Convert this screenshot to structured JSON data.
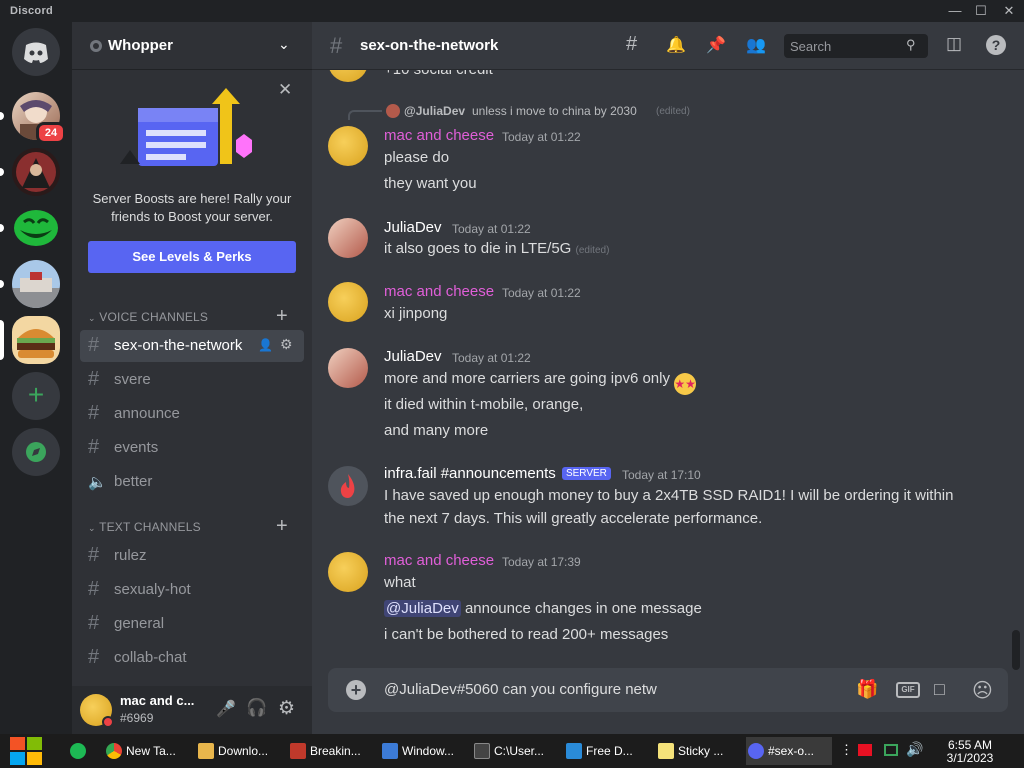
{
  "window": {
    "app_name": "Discord"
  },
  "colors": {
    "blurple": "#5865f2",
    "pink_name": "#e05fd8",
    "green": "#3ba55c",
    "red": "#ed4245"
  },
  "guilds": {
    "unread_badge": "24"
  },
  "server": {
    "name": "Whopper"
  },
  "boost": {
    "text": "Server Boosts are here! Rally your friends to Boost your server.",
    "button": "See Levels & Perks"
  },
  "categories": {
    "voice": "VOICE CHANNELS",
    "text": "TEXT CHANNELS"
  },
  "voice_channels": [
    {
      "label": "sex-on-the-network"
    },
    {
      "label": "svere"
    },
    {
      "label": "announce"
    },
    {
      "label": "events"
    },
    {
      "label": "better"
    }
  ],
  "text_channels": [
    {
      "label": "rulez"
    },
    {
      "label": "sexualy-hot"
    },
    {
      "label": "general"
    },
    {
      "label": "collab-chat"
    }
  ],
  "user": {
    "name": "mac and c...",
    "tag": "#6969"
  },
  "channel_header": {
    "title": "sex-on-the-network",
    "search_placeholder": "Search"
  },
  "messages": {
    "partial": "+10 social credit",
    "reply_user": "@JuliaDev",
    "reply_text": "unless i move to china by 2030",
    "edited": "(edited)",
    "m1": {
      "author": "mac and cheese",
      "time": "Today at 01:22",
      "l1": "please do",
      "l2": "they want you"
    },
    "m2": {
      "author": "JuliaDev",
      "time": "Today at 01:22",
      "l1": "it also goes to die in LTE/5G"
    },
    "m3": {
      "author": "mac and cheese",
      "time": "Today at 01:22",
      "l1": "xi jinpong"
    },
    "m4": {
      "author": "JuliaDev",
      "time": "Today at 01:22",
      "l1": "more and more carriers are going ipv6 only",
      "l2": "it died within t-mobile, orange,",
      "l3": "and many more"
    },
    "m5": {
      "author": "infra.fail #announcements",
      "tag": "SERVER",
      "time": "Today at 17:10",
      "l1": "I have saved up enough money to buy a 2x4TB SSD RAID1! I will be ordering it within",
      "l2": "the next 7 days. This will greatly accelerate performance."
    },
    "m6": {
      "author": "mac and cheese",
      "time": "Today at 17:39",
      "l1": "what",
      "mention": "@JuliaDev",
      "l2": "announce changes in one message",
      "l3": "i can't be bothered to read 200+ messages"
    }
  },
  "composer": {
    "text": "@JuliaDev#5060 can you configure netw"
  },
  "taskbar": {
    "items": [
      {
        "label": "New Ta..."
      },
      {
        "label": "Downlo..."
      },
      {
        "label": "Breakin..."
      },
      {
        "label": "Window..."
      },
      {
        "label": "C:\\User..."
      },
      {
        "label": "Free D..."
      },
      {
        "label": "Sticky ..."
      },
      {
        "label": "#sex-o..."
      }
    ],
    "time": "6:55 AM",
    "date": "3/1/2023"
  }
}
